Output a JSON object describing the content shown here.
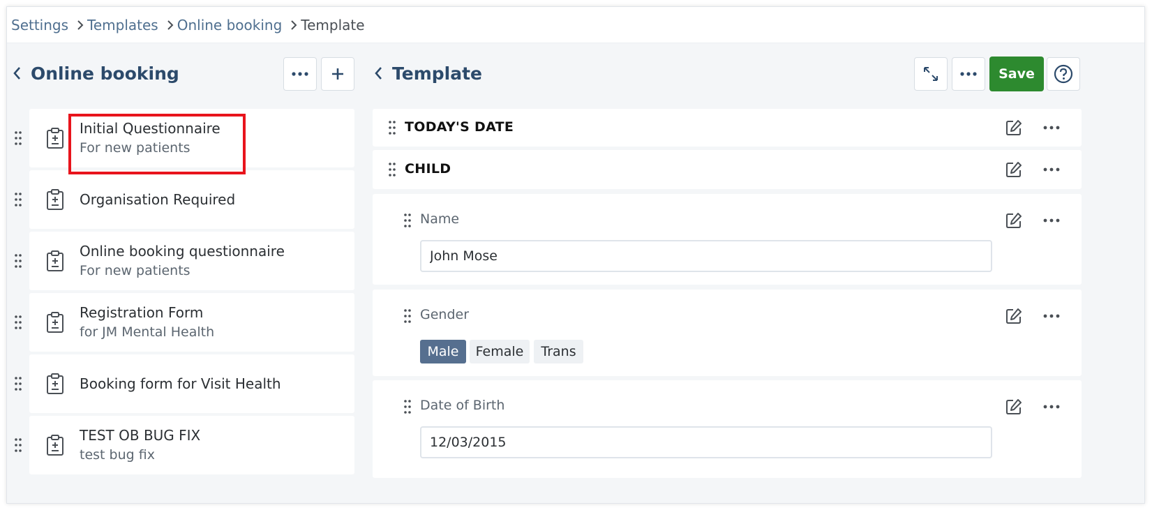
{
  "breadcrumb": {
    "items": [
      {
        "label": "Settings"
      },
      {
        "label": "Templates"
      },
      {
        "label": "Online booking"
      },
      {
        "label": "Template"
      }
    ]
  },
  "left_panel": {
    "title": "Online booking",
    "items": [
      {
        "title": "Initial Questionnaire",
        "subtitle": "For new patients"
      },
      {
        "title": "Organisation Required",
        "subtitle": ""
      },
      {
        "title": "Online booking questionnaire",
        "subtitle": "For new patients"
      },
      {
        "title": "Registration Form",
        "subtitle": "for JM Mental Health"
      },
      {
        "title": "Booking form for Visit Health",
        "subtitle": ""
      },
      {
        "title": "TEST OB BUG FIX",
        "subtitle": "test bug fix"
      }
    ]
  },
  "right_panel": {
    "title": "Template",
    "save_label": "Save",
    "sections": [
      {
        "label": "TODAY'S DATE"
      },
      {
        "label": "CHILD"
      }
    ],
    "fields": {
      "name": {
        "label": "Name",
        "value": "John Mose"
      },
      "gender": {
        "label": "Gender",
        "options": [
          "Male",
          "Female",
          "Trans"
        ],
        "selected": "Male"
      },
      "dob": {
        "label": "Date of Birth",
        "value": "12/03/2015"
      }
    }
  },
  "colors": {
    "accent": "#2c4a6b",
    "save": "#2d8a2f",
    "selected_chip": "#566f8f",
    "highlight": "#e8141c"
  }
}
